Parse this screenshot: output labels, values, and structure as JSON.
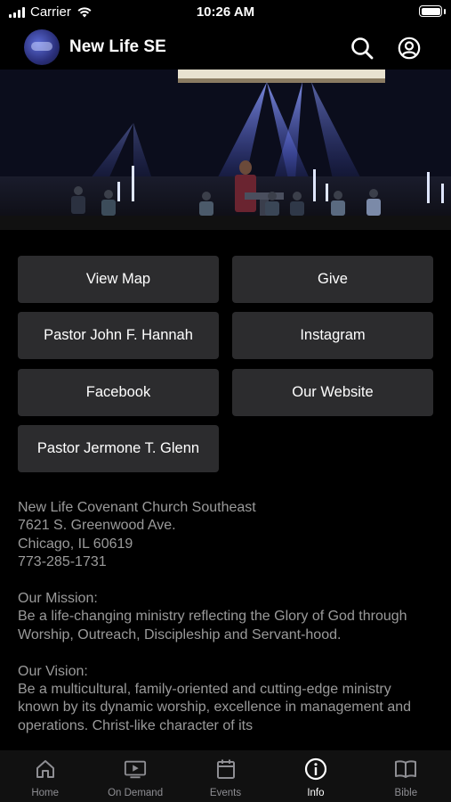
{
  "status_bar": {
    "carrier": "Carrier",
    "time": "10:26 AM"
  },
  "header": {
    "title": "New Life SE"
  },
  "buttons": [
    {
      "label": "View Map"
    },
    {
      "label": "Give"
    },
    {
      "label": "Pastor John F. Hannah"
    },
    {
      "label": "Instagram"
    },
    {
      "label": "Facebook"
    },
    {
      "label": "Our Website"
    },
    {
      "label": "Pastor Jermone T. Glenn"
    }
  ],
  "info": {
    "church_name": "New Life Covenant Church Southeast",
    "address_line1": "7621 S. Greenwood Ave.",
    "address_line2": "Chicago, IL 60619",
    "phone": "773-285-1731",
    "mission_heading": "Our Mission:",
    "mission_text": "Be a life-changing ministry reflecting the Glory of God through Worship, Outreach, Discipleship and Servant-hood.",
    "vision_heading": "Our Vision:",
    "vision_text": "Be a multicultural, family-oriented and cutting-edge ministry known by its dynamic worship, excellence in management and operations. Christ-like character of its"
  },
  "tabs": [
    {
      "label": "Home",
      "icon": "home-icon"
    },
    {
      "label": "On Demand",
      "icon": "play-icon"
    },
    {
      "label": "Events",
      "icon": "calendar-icon"
    },
    {
      "label": "Info",
      "icon": "info-icon",
      "active": true
    },
    {
      "label": "Bible",
      "icon": "book-icon"
    }
  ]
}
